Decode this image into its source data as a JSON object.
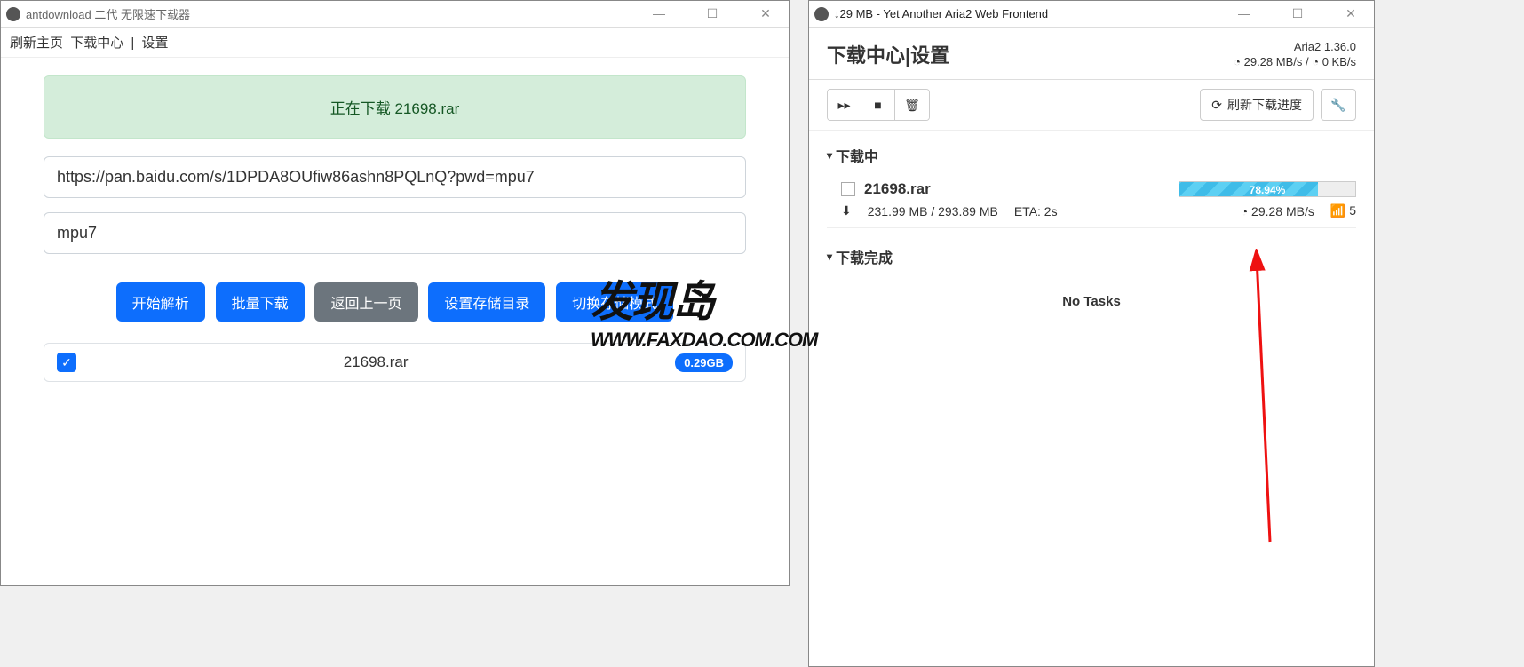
{
  "left": {
    "title": "antdownload 二代 无限速下载器",
    "menu": {
      "refresh": "刷新主页",
      "center": "下载中心",
      "sep": "|",
      "settings": "设置"
    },
    "banner": "正在下载 21698.rar",
    "url": "https://pan.baidu.com/s/1DPDA8OUfiw86ashn8PQLnQ?pwd=mpu7",
    "pwd": "mpu7",
    "buttons": {
      "parse": "开始解析",
      "batch": "批量下载",
      "back": "返回上一页",
      "setdir": "设置存储目录",
      "switchmode": "切换存储模式"
    },
    "file": {
      "name": "21698.rar",
      "size": "0.29GB"
    },
    "winctrl": {
      "min": "—",
      "max": "☐",
      "close": "✕"
    }
  },
  "right": {
    "title": "↓29 MB - Yet Another Aria2 Web Frontend",
    "winctrl": {
      "min": "—",
      "max": "☐",
      "close": "✕"
    },
    "header": {
      "title": "下载中心|设置",
      "version": "Aria2 1.36.0",
      "dlspeed": "29.28 MB/s",
      "ulspeed": "0 KB/s"
    },
    "toolbar": {
      "refresh_label": "刷新下载进度"
    },
    "sections": {
      "downloading": "下载中",
      "completed": "下载完成",
      "no_tasks": "No Tasks"
    },
    "task": {
      "name": "21698.rar",
      "progress_pct": "78.94%",
      "progress_val": 78.94,
      "downloaded": "231.99 MB",
      "total": "293.89 MB",
      "eta_label": "ETA: 2s",
      "speed": "29.28 MB/s",
      "conns": "5"
    }
  },
  "watermark": {
    "line1": "发现岛",
    "line2": "WWW.FAXDAO.COM.COM"
  },
  "glyph": {
    "play_ff": "▸▸",
    "stop": "■",
    "trash": "🗑",
    "refresh": "⟳",
    "wrench": "🔧",
    "download": "⬇",
    "clock": "◔",
    "signal": "📶",
    "caret_down": "▾"
  }
}
